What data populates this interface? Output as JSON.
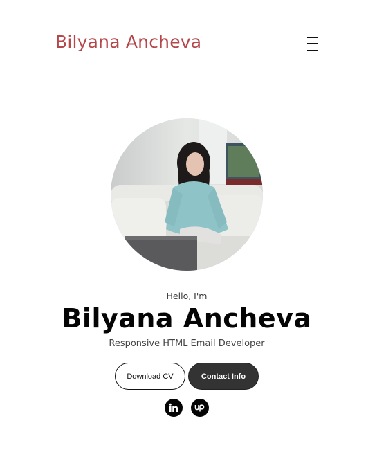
{
  "header": {
    "brand": "Bilyana Ancheva",
    "menu_icon": "hamburger-menu-icon"
  },
  "hero": {
    "photo_alt": "Bilyana Ancheva",
    "greeting": "Hello, I'm",
    "name": "Bilyana Ancheva",
    "role": "Responsive HTML Email Developer"
  },
  "actions": {
    "download_cv": "Download CV",
    "contact_info": "Contact Info"
  },
  "social": {
    "linkedin_icon": "linkedin-icon",
    "upwork_icon": "upwork-icon"
  },
  "colors": {
    "brand": "#b5474b",
    "dark_button": "#333333",
    "text": "#050505"
  }
}
